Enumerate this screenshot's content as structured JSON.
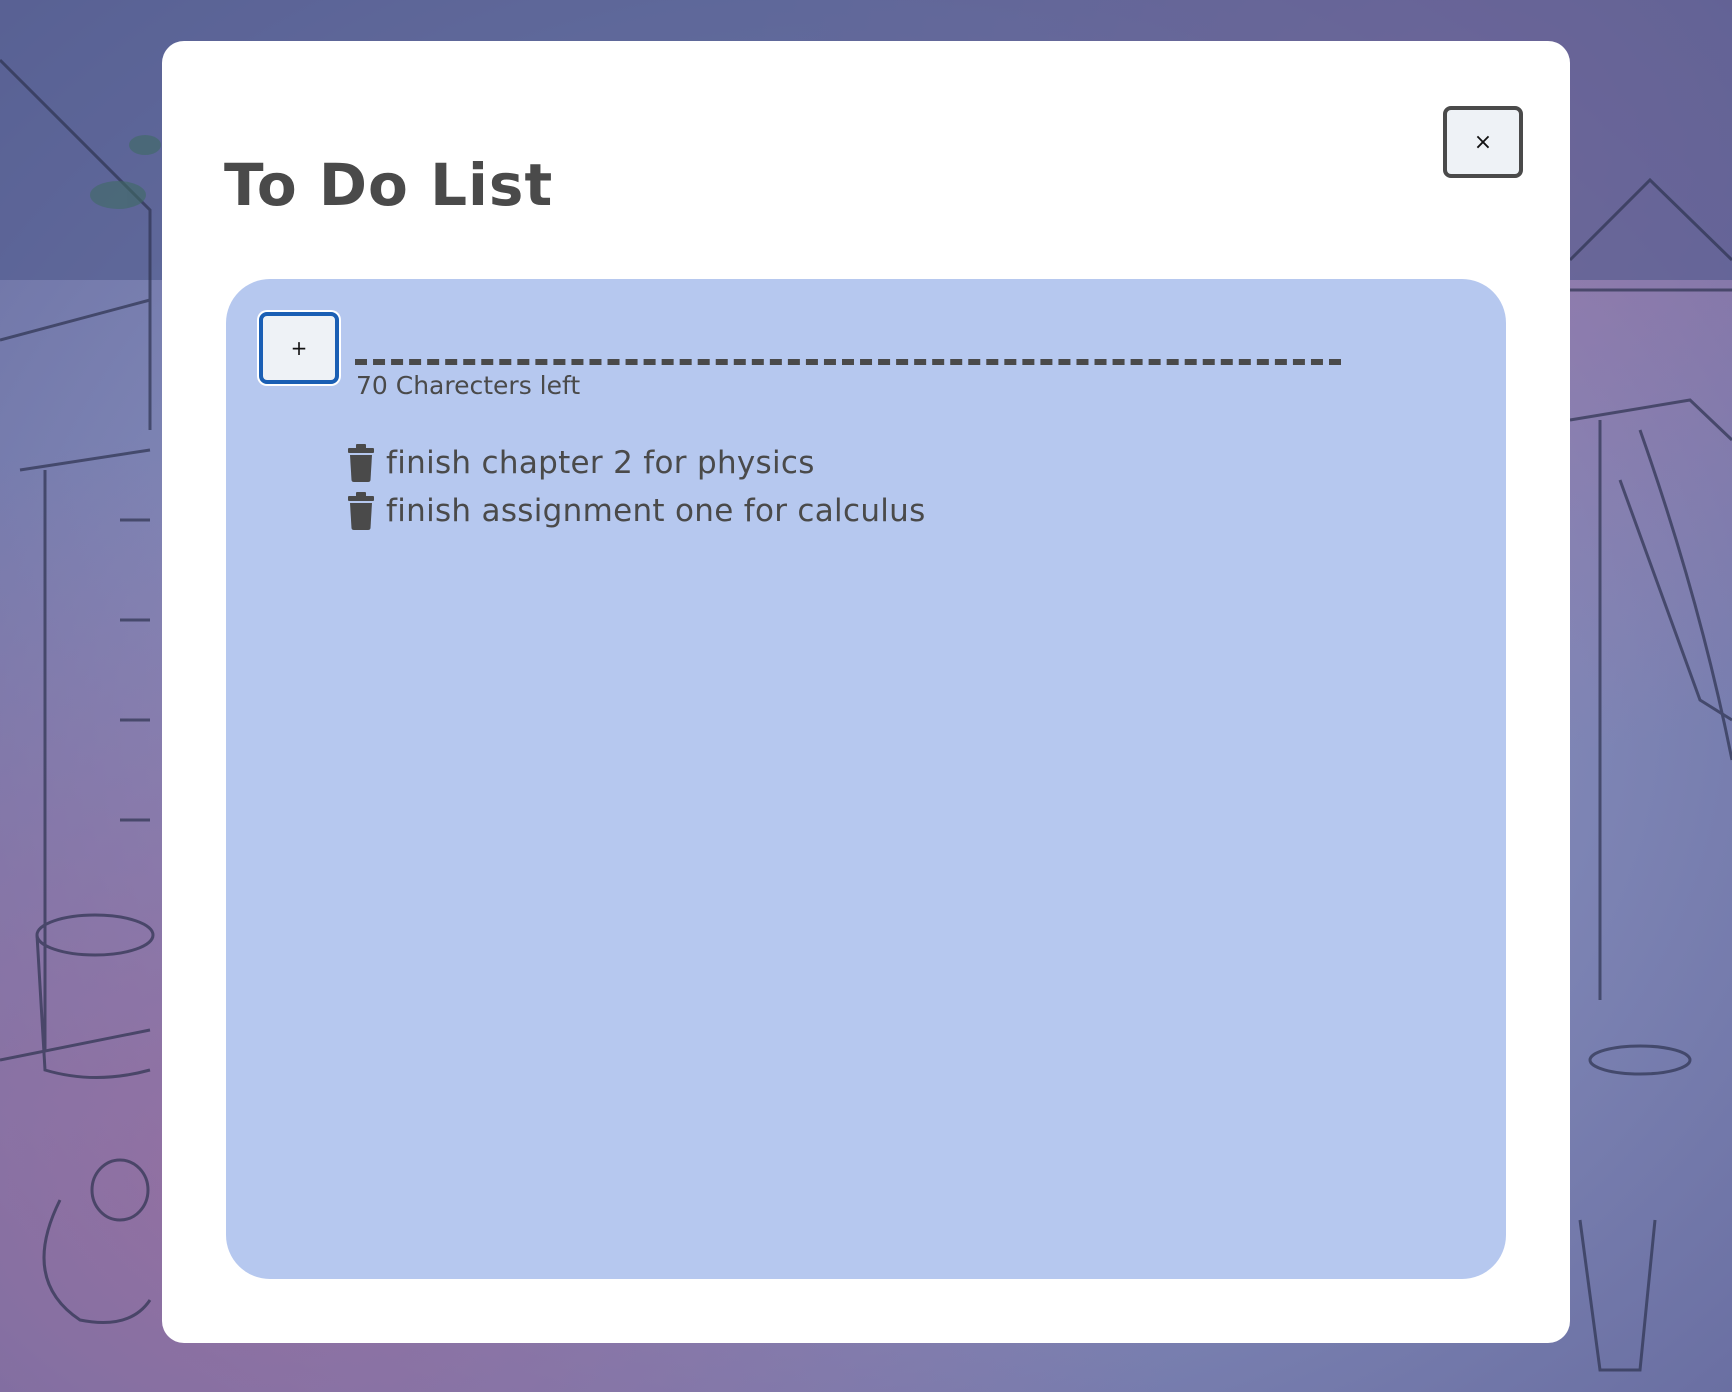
{
  "modal": {
    "title": "To Do List",
    "close_label": "×"
  },
  "composer": {
    "add_label": "+",
    "input_value": "",
    "input_placeholder": "",
    "chars_left": "70 Charecters left"
  },
  "todos": [
    {
      "text": "finish chapter 2 for physics",
      "icon": "trash-icon"
    },
    {
      "text": "finish assignment one for calculus",
      "icon": "trash-icon"
    }
  ],
  "colors": {
    "panel": "#b6c8ef",
    "text": "#4a4a4a",
    "focus_ring": "#1a5fb4"
  }
}
